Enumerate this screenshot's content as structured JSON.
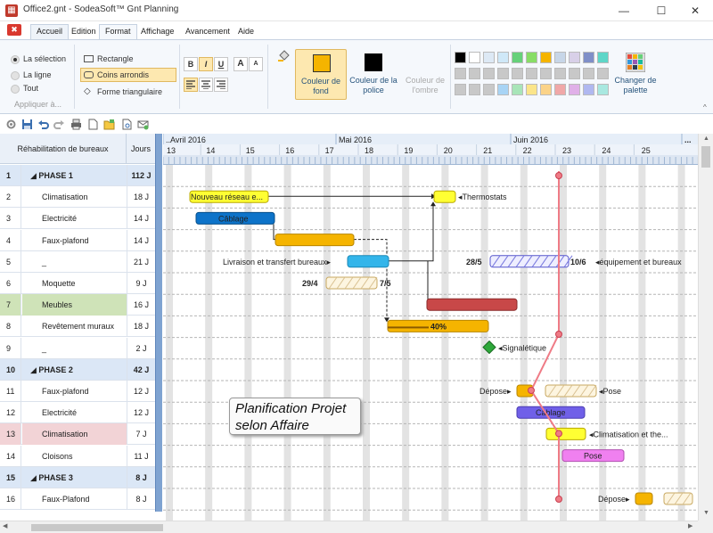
{
  "window": {
    "title": "Office2.gnt - SodeaSoft™ Gnt Planning",
    "minimize": "—",
    "maximize": "☐",
    "close": "✕"
  },
  "menu": {
    "close_tab": "✖",
    "tabs": [
      "Accueil",
      "Edition",
      "Format",
      "Affichage",
      "Avancement",
      "Aide"
    ],
    "active_tab": "Format"
  },
  "ribbon": {
    "apply_scope": {
      "options": [
        "La sélection",
        "La ligne",
        "Tout"
      ],
      "selected": "La sélection",
      "group_label": "Appliquer à..."
    },
    "shape_options": {
      "options": [
        "Rectangle",
        "Coins arrondis",
        "Forme triangulaire"
      ],
      "selected": "Coins arrondis"
    },
    "font_buttons": {
      "bold": "B",
      "italic": "I",
      "underline": "U",
      "grow": "A",
      "shrink": "A"
    },
    "fill_color_label": "Couleur de fond",
    "font_color_label": "Couleur de la police",
    "shadow_color_label": "Couleur de l'ombre",
    "palette_button_label": "Changer de palette",
    "palette": [
      [
        "#000000",
        "#ffffff",
        "#dde9f5",
        "#cfe8f8",
        "#66d17a",
        "#88dd66",
        "#f5b400",
        "#c7d6e8",
        "#d8d0e8",
        "#7f8fc8",
        "#5ed6c8"
      ],
      [
        "#c8c8c8",
        "#c8c8c8",
        "#c8c8c8",
        "#c8c8c8",
        "#c8c8c8",
        "#c8c8c8",
        "#c8c8c8",
        "#c8c8c8",
        "#c8c8c8",
        "#c8c8c8",
        "#c8c8c8"
      ],
      [
        "#c8c8c8",
        "#c8c8c8",
        "#c8c8c8",
        "#a8d4f5",
        "#a8e5b8",
        "#fbe58a",
        "#fbd388",
        "#f0a8a8",
        "#e0b0e8",
        "#b0b8f0",
        "#a8e8e0"
      ]
    ],
    "fill_swatch": "#f5b400",
    "font_swatch": "#000000"
  },
  "grid": {
    "header_title": "Réhabilitation de bureaux",
    "header_duration": "Jours",
    "rows": [
      {
        "n": "1",
        "name": "◢ PHASE 1",
        "dur": "112 J",
        "kind": "phase"
      },
      {
        "n": "2",
        "name": "Climatisation",
        "dur": "18 J",
        "kind": "task"
      },
      {
        "n": "3",
        "name": "Electricité",
        "dur": "14 J",
        "kind": "task"
      },
      {
        "n": "4",
        "name": "Faux-plafond",
        "dur": "14 J",
        "kind": "task"
      },
      {
        "n": "5",
        "name": "_",
        "dur": "21 J",
        "kind": "task"
      },
      {
        "n": "6",
        "name": "Moquette",
        "dur": "9 J",
        "kind": "task"
      },
      {
        "n": "7",
        "name": "Meubles",
        "dur": "16 J",
        "kind": "green"
      },
      {
        "n": "8",
        "name": "Revêtement muraux",
        "dur": "18 J",
        "kind": "task"
      },
      {
        "n": "9",
        "name": "_",
        "dur": "2 J",
        "kind": "task"
      },
      {
        "n": "10",
        "name": "◢ PHASE 2",
        "dur": "42 J",
        "kind": "phase"
      },
      {
        "n": "11",
        "name": "Faux-plafond",
        "dur": "12 J",
        "kind": "task"
      },
      {
        "n": "12",
        "name": "Electricité",
        "dur": "12 J",
        "kind": "task"
      },
      {
        "n": "13",
        "name": "Climatisation",
        "dur": "7 J",
        "kind": "pink"
      },
      {
        "n": "14",
        "name": "Cloisons",
        "dur": "11 J",
        "kind": "task"
      },
      {
        "n": "15",
        "name": "◢ PHASE 3",
        "dur": "8 J",
        "kind": "phase"
      },
      {
        "n": "16",
        "name": "Faux-Plafond",
        "dur": "8 J",
        "kind": "task"
      }
    ]
  },
  "timeline": {
    "months": [
      "..Avril 2016",
      "Mai 2016",
      "Juin 2016",
      "..."
    ],
    "weeks": [
      "13",
      "14",
      "15",
      "16",
      "17",
      "18",
      "19",
      "20",
      "21",
      "22",
      "23",
      "24",
      "25"
    ]
  },
  "gantt": {
    "row2_task": "Nouveau réseau e...",
    "row2_milestone": "Thermostats",
    "row3_task": "Câblage",
    "row5_left": "Livraison et transfert bureaux",
    "row5_start": "28/5",
    "row5_end": "10/6",
    "row5_right": "équipement et bureaux",
    "row6_start": "29/4",
    "row6_end": "7/5",
    "row8_progress": "40%",
    "row9_label": "Signalétique",
    "row11_left": "Dépose",
    "row11_right": "Pose",
    "row12_task": "Câblage",
    "row13_right": "Climatisation et the...",
    "row14_task": "Pose",
    "row16_left": "Dépose"
  },
  "watermark": {
    "line1": "Planification Projet",
    "line2": "selon Affaire"
  }
}
